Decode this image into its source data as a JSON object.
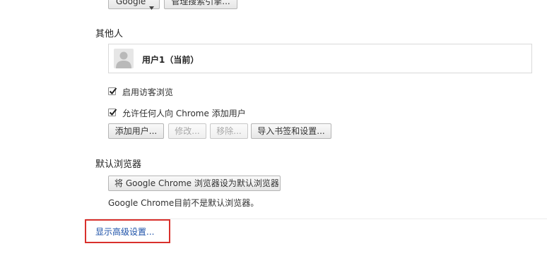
{
  "search": {
    "engine_select_value": "Google",
    "manage_button": "管理搜索引擎..."
  },
  "people": {
    "title": "其他人",
    "profile_name": "用户1（当前）",
    "guest_checkbox_label": "启用访客浏览",
    "guest_checked": true,
    "add_anyone_checkbox_label": "允许任何人向 Chrome 添加用户",
    "add_anyone_checked": true,
    "buttons": {
      "add": "添加用户...",
      "edit": "修改...",
      "remove": "移除...",
      "import": "导入书签和设置..."
    }
  },
  "default_browser": {
    "title": "默认浏览器",
    "set_default_button": "将 Google Chrome 浏览器设为默认浏览器",
    "status_text": "Google Chrome目前不是默认浏览器。"
  },
  "advanced": {
    "link_label": "显示高级设置..."
  },
  "colors": {
    "link": "#1c51a8",
    "highlight_border": "#d9302c"
  },
  "icons": {
    "avatar": "person-avatar-icon",
    "dropdown": "triangle-down-icon",
    "check": "checkmark-icon"
  }
}
